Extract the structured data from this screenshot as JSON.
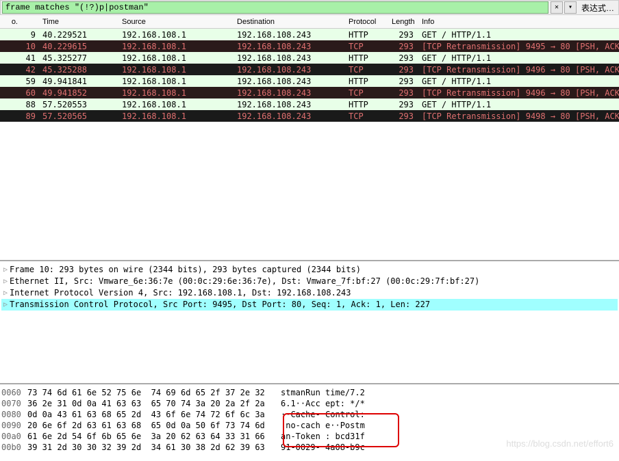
{
  "filter": {
    "value": "frame matches \"(!?)p|postman\"",
    "close_label": "✕",
    "dropdown_label": "▾",
    "expr_label": "表达式…"
  },
  "columns": {
    "no": "o.",
    "time": "Time",
    "source": "Source",
    "dest": "Destination",
    "protocol": "Protocol",
    "length": "Length",
    "info": "Info"
  },
  "packets": [
    {
      "no": "9",
      "time": "40.229521",
      "src": "192.168.108.1",
      "dst": "192.168.108.243",
      "proto": "HTTP",
      "len": "293",
      "info": "GET / HTTP/1.1",
      "style": "http"
    },
    {
      "no": "10",
      "time": "40.229615",
      "src": "192.168.108.1",
      "dst": "192.168.108.243",
      "proto": "TCP",
      "len": "293",
      "info": "[TCP Retransmission] 9495 → 80 [PSH, ACK",
      "style": "tcp-dark"
    },
    {
      "no": "41",
      "time": "45.325277",
      "src": "192.168.108.1",
      "dst": "192.168.108.243",
      "proto": "HTTP",
      "len": "293",
      "info": "GET / HTTP/1.1",
      "style": "http"
    },
    {
      "no": "42",
      "time": "45.325288",
      "src": "192.168.108.1",
      "dst": "192.168.108.243",
      "proto": "TCP",
      "len": "293",
      "info": "[TCP Retransmission] 9496 → 80 [PSH, ACK",
      "style": "tcp-black"
    },
    {
      "no": "59",
      "time": "49.941841",
      "src": "192.168.108.1",
      "dst": "192.168.108.243",
      "proto": "HTTP",
      "len": "293",
      "info": "GET / HTTP/1.1",
      "style": "http"
    },
    {
      "no": "60",
      "time": "49.941852",
      "src": "192.168.108.1",
      "dst": "192.168.108.243",
      "proto": "TCP",
      "len": "293",
      "info": "[TCP Retransmission] 9496 → 80 [PSH, ACK",
      "style": "tcp-dark"
    },
    {
      "no": "88",
      "time": "57.520553",
      "src": "192.168.108.1",
      "dst": "192.168.108.243",
      "proto": "HTTP",
      "len": "293",
      "info": "GET / HTTP/1.1",
      "style": "http"
    },
    {
      "no": "89",
      "time": "57.520565",
      "src": "192.168.108.1",
      "dst": "192.168.108.243",
      "proto": "TCP",
      "len": "293",
      "info": "[TCP Retransmission] 9498 → 80 [PSH, ACK",
      "style": "tcp-black"
    }
  ],
  "details": [
    {
      "text": "Frame 10: 293 bytes on wire (2344 bits), 293 bytes captured (2344 bits)",
      "hl": false
    },
    {
      "text": "Ethernet II, Src: Vmware_6e:36:7e (00:0c:29:6e:36:7e), Dst: Vmware_7f:bf:27 (00:0c:29:7f:bf:27)",
      "hl": false
    },
    {
      "text": "Internet Protocol Version 4, Src: 192.168.108.1, Dst: 192.168.108.243",
      "hl": false
    },
    {
      "text": "Transmission Control Protocol, Src Port: 9495, Dst Port: 80, Seq: 1, Ack: 1, Len: 227",
      "hl": true
    }
  ],
  "bytes": [
    {
      "off": "0060",
      "hex": "73 74 6d 61 6e 52 75 6e  74 69 6d 65 2f 37 2e 32",
      "ascii": "stmanRun time/7.2"
    },
    {
      "off": "0070",
      "hex": "36 2e 31 0d 0a 41 63 63  65 70 74 3a 20 2a 2f 2a",
      "ascii": "6.1··Acc ept: */*"
    },
    {
      "off": "0080",
      "hex": "0d 0a 43 61 63 68 65 2d  43 6f 6e 74 72 6f 6c 3a",
      "ascii": "··Cache- Control:"
    },
    {
      "off": "0090",
      "hex": "20 6e 6f 2d 63 61 63 68  65 0d 0a 50 6f 73 74 6d",
      "ascii": " no-cach e··Postm"
    },
    {
      "off": "00a0",
      "hex": "61 6e 2d 54 6f 6b 65 6e  3a 20 62 63 64 33 31 66",
      "ascii": "an-Token : bcd31f"
    },
    {
      "off": "00b0",
      "hex": "39 31 2d 30 30 32 39 2d  34 61 30 38 2d 62 39 63",
      "ascii": "91-0029- 4a08-b9c"
    }
  ],
  "watermark": "https://blog.csdn.net/effort6"
}
